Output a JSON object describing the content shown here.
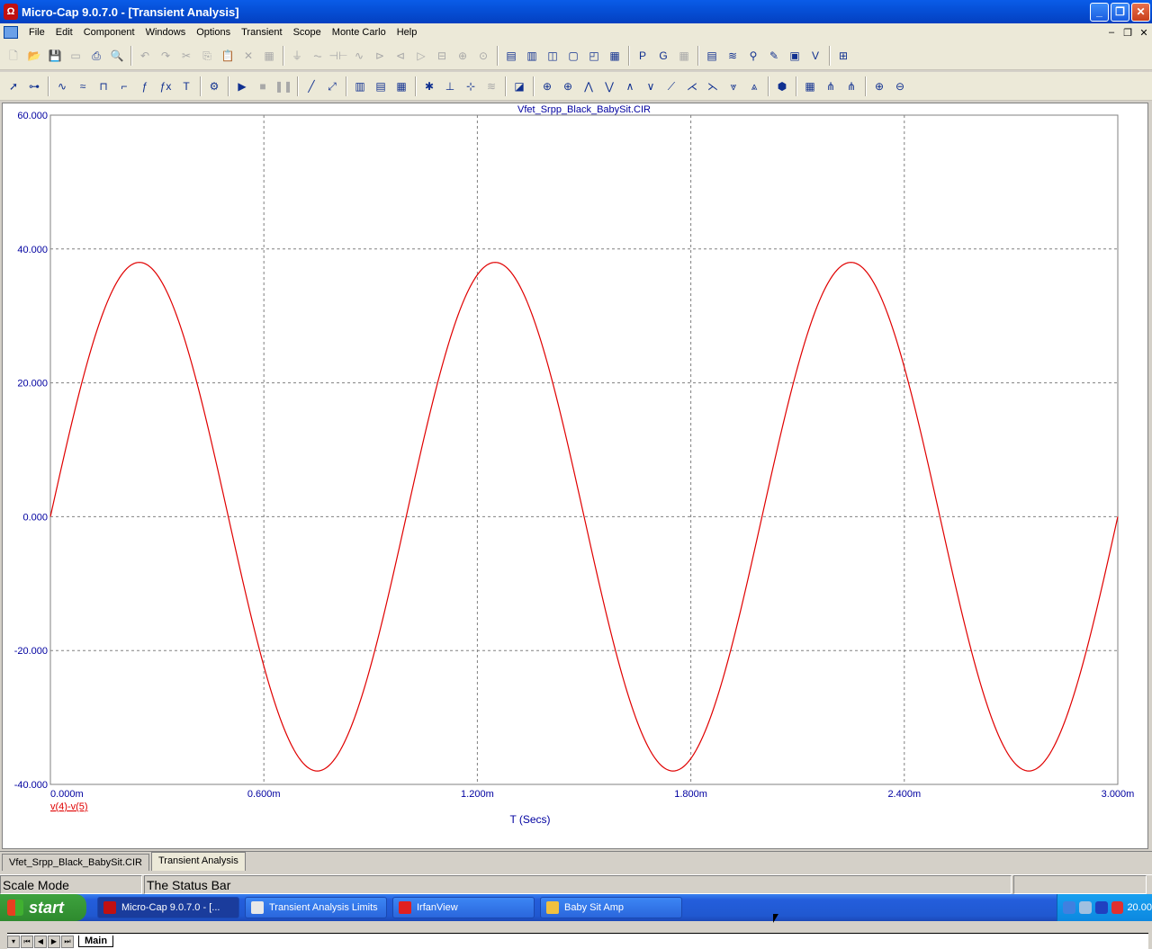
{
  "window": {
    "title": "Micro-Cap 9.0.7.0 - [Transient Analysis]",
    "min": "_",
    "max": "❐",
    "close": "✕"
  },
  "menu": [
    "File",
    "Edit",
    "Component",
    "Windows",
    "Options",
    "Transient",
    "Scope",
    "Monte Carlo",
    "Help"
  ],
  "mdi": [
    "–",
    "❐",
    "✕"
  ],
  "toolbar1": [
    {
      "name": "new-icon",
      "g": "🗋",
      "dim": true
    },
    {
      "name": "open-icon",
      "g": "📂",
      "dim": true
    },
    {
      "name": "save-icon",
      "g": "💾",
      "dim": true
    },
    {
      "name": "close-file-icon",
      "g": "▭",
      "dim": true
    },
    {
      "name": "print-icon",
      "g": "⎙"
    },
    {
      "name": "print-preview-icon",
      "g": "🔍"
    },
    "|",
    {
      "name": "undo-icon",
      "g": "↶",
      "dim": true
    },
    {
      "name": "redo-icon",
      "g": "↷",
      "dim": true
    },
    {
      "name": "cut-icon",
      "g": "✂",
      "dim": true
    },
    {
      "name": "copy-icon",
      "g": "⎘",
      "dim": true
    },
    {
      "name": "paste-icon",
      "g": "📋",
      "dim": true
    },
    {
      "name": "delete-icon",
      "g": "✕",
      "dim": true
    },
    {
      "name": "select-all-icon",
      "g": "▦",
      "dim": true
    },
    "|",
    {
      "name": "ground-icon",
      "g": "⏚",
      "dim": true
    },
    {
      "name": "resistor-icon",
      "g": "⏦",
      "dim": true
    },
    {
      "name": "capacitor-icon",
      "g": "⊣⊢",
      "dim": true
    },
    {
      "name": "inductor-icon",
      "g": "∿",
      "dim": true
    },
    {
      "name": "diode-icon",
      "g": "⊳",
      "dim": true
    },
    {
      "name": "npn-icon",
      "g": "⊲",
      "dim": true
    },
    {
      "name": "opamp-icon",
      "g": "▷",
      "dim": true
    },
    {
      "name": "battery-icon",
      "g": "⊟",
      "dim": true
    },
    {
      "name": "source-icon",
      "g": "⊕",
      "dim": true
    },
    {
      "name": "current-icon",
      "g": "⊙",
      "dim": true
    },
    "|",
    {
      "name": "tile-h-icon",
      "g": "▤"
    },
    {
      "name": "tile-v-icon",
      "g": "▥"
    },
    {
      "name": "cascade-icon",
      "g": "◫"
    },
    {
      "name": "window-icon",
      "g": "▢"
    },
    {
      "name": "split-icon",
      "g": "◰"
    },
    {
      "name": "calculator-icon",
      "g": "▦"
    },
    "|",
    {
      "name": "p-icon",
      "g": "P"
    },
    {
      "name": "g-icon",
      "g": "G"
    },
    {
      "name": "grid-icon",
      "g": "▦",
      "dim": true
    },
    "|",
    {
      "name": "numeric-output-icon",
      "g": "▤"
    },
    {
      "name": "waveform-icon",
      "g": "≋"
    },
    {
      "name": "probe-icon",
      "g": "⚲"
    },
    {
      "name": "marker-icon",
      "g": "✎"
    },
    {
      "name": "plot-properties-icon",
      "g": "▣"
    },
    {
      "name": "vt-icon",
      "g": "V"
    },
    "|",
    {
      "name": "zoom-fit-icon",
      "g": "⊞"
    }
  ],
  "toolbar2": [
    {
      "name": "select-arrow-icon",
      "g": "➚"
    },
    {
      "name": "component-icon",
      "g": "⊶"
    },
    "|",
    {
      "name": "scale-icon",
      "g": "∿"
    },
    {
      "name": "wave-icon",
      "g": "≈"
    },
    {
      "name": "pulse-icon",
      "g": "⊓"
    },
    {
      "name": "step-icon",
      "g": "⌐"
    },
    {
      "name": "fx-icon",
      "g": "ƒ"
    },
    {
      "name": "formula-icon",
      "g": "ƒx"
    },
    {
      "name": "text-icon",
      "g": "T"
    },
    "|",
    {
      "name": "properties-icon",
      "g": "⚙"
    },
    "|",
    {
      "name": "run-icon",
      "g": "▶"
    },
    {
      "name": "stop-icon",
      "g": "■",
      "dim": true
    },
    {
      "name": "pause-icon",
      "g": "❚❚",
      "dim": true
    },
    "|",
    {
      "name": "line-icon",
      "g": "╱"
    },
    {
      "name": "diagonal-icon",
      "g": "⤢"
    },
    "|",
    {
      "name": "data-points-icon",
      "g": "▥"
    },
    {
      "name": "tokens-icon",
      "g": "▤"
    },
    {
      "name": "grid-toggle-icon",
      "g": "▦"
    },
    "|",
    {
      "name": "cursor-a-icon",
      "g": "✱"
    },
    {
      "name": "cursor-b-icon",
      "g": "⊥"
    },
    {
      "name": "cursor-c-icon",
      "g": "⊹"
    },
    {
      "name": "smooth-icon",
      "g": "≋",
      "dim": true
    },
    "|",
    {
      "name": "scope-icon",
      "g": "◪"
    },
    "|",
    {
      "name": "peak-icon",
      "g": "⊕"
    },
    {
      "name": "valley-icon",
      "g": "⊕"
    },
    {
      "name": "high-icon",
      "g": "⋀"
    },
    {
      "name": "low-icon",
      "g": "⋁"
    },
    {
      "name": "inflection-icon",
      "g": "∧"
    },
    {
      "name": "global-high-icon",
      "g": "∨"
    },
    {
      "name": "global-low-icon",
      "g": "⟋"
    },
    {
      "name": "top-icon",
      "g": "⋌"
    },
    {
      "name": "bottom-icon",
      "g": "⋋"
    },
    {
      "name": "next-icon",
      "g": "⩔"
    },
    {
      "name": "prev-icon",
      "g": "⩓"
    },
    "|",
    {
      "name": "libraries-icon",
      "g": "⬢"
    },
    "|",
    {
      "name": "table-icon",
      "g": "▦"
    },
    {
      "name": "axes-a-icon",
      "g": "⋔"
    },
    {
      "name": "axes-b-icon",
      "g": "⋔"
    },
    "|",
    {
      "name": "zoom-in-icon",
      "g": "⊕"
    },
    {
      "name": "zoom-out-icon",
      "g": "⊖"
    }
  ],
  "plot": {
    "title": "Vfet_Srpp_Black_BabySit.CIR",
    "trace_label": "v(4)-v(5)",
    "xlabel": "T (Secs)"
  },
  "chart_data": {
    "type": "line",
    "title": "Vfet_Srpp_Black_BabySit.CIR",
    "xlabel": "T (Secs)",
    "ylabel": "",
    "xlim": [
      0,
      3.0
    ],
    "ylim": [
      -40,
      60
    ],
    "x_ticks": [
      "0.000m",
      "0.600m",
      "1.200m",
      "1.800m",
      "2.400m",
      "3.000m"
    ],
    "y_ticks": [
      "60.000",
      "40.000",
      "20.000",
      "0.000",
      "-20.000",
      "-40.000"
    ],
    "grid": true,
    "series": [
      {
        "name": "v(4)-v(5)",
        "color": "#e00000",
        "amplitude": 38,
        "frequency_khz": 1.0,
        "x_unit": "ms"
      }
    ]
  },
  "sheet_nav": [
    "▾",
    "⏮",
    "◀",
    "▶",
    "⏭"
  ],
  "sheet_tab": "Main",
  "doc_tabs": [
    {
      "label": "Vfet_Srpp_Black_BabySit.CIR",
      "active": false
    },
    {
      "label": "Transient Analysis",
      "active": true
    }
  ],
  "status": {
    "mode": "Scale Mode",
    "message": "The Status Bar"
  },
  "taskbar": {
    "start": "start",
    "tasks": [
      {
        "label": "Micro-Cap 9.0.7.0 - [...",
        "color": "#c01010",
        "active": true
      },
      {
        "label": "Transient Analysis Limits",
        "color": "#e8e8e8",
        "active": false
      },
      {
        "label": "IrfanView",
        "color": "#e02020",
        "active": false
      },
      {
        "label": "Baby Sit Amp",
        "color": "#f0c040",
        "active": false
      }
    ],
    "clock": "20.00"
  }
}
